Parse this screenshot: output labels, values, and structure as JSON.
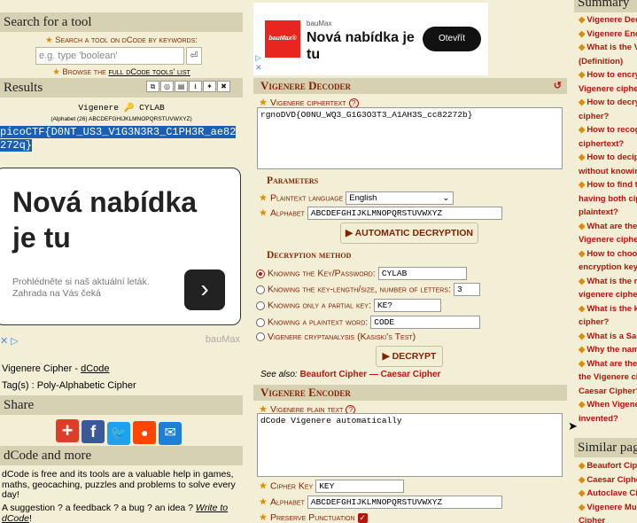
{
  "left": {
    "search_title": "Search for a tool",
    "search_hint": "Search a tool on dCode by keywords:",
    "search_placeholder": "e.g. type 'boolean'",
    "browse_prefix": "Browse the ",
    "browse_link": "full dCode tools' list",
    "results_title": "Results",
    "result_tool": "Vigenere",
    "result_key": "CYLAB",
    "result_alphabet": "(Alphabet (26) ABCDEFGHIJKLMNOPQRSTUVWXYZ)",
    "result_text_line1": "picoCTF{D0NT_US3_V1G3N3R3_C1PH3R_ae82",
    "result_text_line2": "272q}",
    "ad_title": "Nová nabídka je tu",
    "ad_text": "Prohlédněte si naš aktuální leták. Zahrada na Vás čeká",
    "ad_brand": "bauMax",
    "tool_name_prefix": "Vigenere Cipher - ",
    "tool_name_link": "dCode",
    "tags": "Tag(s) : Poly-Alphabetic Cipher",
    "share_title": "Share",
    "more_title": "dCode and more",
    "more_text_1": "dCode is free and its tools are a valuable help in games, maths, geocaching, puzzles and problems to solve every day!",
    "more_text_2a": "A suggestion ? a feedback ? a bug ? an idea ? ",
    "more_text_2b": "Write to dCode",
    "more_text_2c": "!",
    "toolbar_icons": [
      "copy-icon",
      "screenshot-icon",
      "print-icon",
      "download-icon",
      "pin-icon",
      "close-icon"
    ]
  },
  "top_ad": {
    "brand": "bauMax",
    "logo_text": "bauMax®",
    "title": "Nová nabídka je tu",
    "button": "Otevřít"
  },
  "decoder": {
    "title": "Vigenere Decoder",
    "cipher_label": "Vigenere ciphertext",
    "cipher_value": "rgnoDVD{O0NU_WQ3_G1G3O3T3_A1AH3S_cc82272b}",
    "params_title": "Parameters",
    "lang_label": "Plaintext language",
    "lang_value": "English",
    "alphabet_label": "Alphabet",
    "alphabet_value": "ABCDEFGHIJKLMNOPQRSTUVWXYZ",
    "auto_button": "▶ AUTOMATIC DECRYPTION",
    "method_title": "Decryption method",
    "opt1_label": "Knowing the Key/Password:",
    "opt1_value": "CYLAB",
    "opt2_label": "Knowing the key-length/size, number of letters:",
    "opt2_value": "3",
    "opt3_label": "Knowing only a partial key:",
    "opt3_value": "KE?",
    "opt4_label": "Knowing a plaintext word:",
    "opt4_value": "CODE",
    "opt5_label": "Vigenere cryptanalysis (Kasiski's Test)",
    "decrypt_button": "▶ DECRYPT",
    "see_also": "See also:",
    "see_link1": "Beaufort Cipher",
    "see_dash": " — ",
    "see_link2": "Caesar Cipher"
  },
  "encoder": {
    "title": "Vigenere Encoder",
    "plain_label": "Vigenere plain text",
    "plain_value": "dCode Vigenere automatically",
    "key_label": "Cipher Key",
    "key_value": "KEY",
    "alphabet_label": "Alphabet",
    "alphabet_value": "ABCDEFGHIJKLMNOPQRSTUVWXYZ",
    "punct_label": "Preserve Punctuation"
  },
  "summary": {
    "title": "Summary",
    "items": [
      "Vigenere Dec",
      "Vigenere Enc",
      "What is the V",
      "(Definition)",
      "How to encry",
      "Vigenere ciphe",
      "How to decry",
      "cipher?",
      "How to recog",
      "ciphertext?",
      "How to decip",
      "without knowin",
      "How to find t",
      "having both cip",
      "plaintext?",
      "What are the",
      "Vigenere ciphe",
      "How to choo",
      "encryption key",
      "What is the r",
      "vigenere ciphe",
      "What is the k",
      "cipher?",
      "What is a Sa",
      "Why the nam",
      "What are the",
      "the Vigenere ci",
      "Caesar Cipher?",
      "When Vigene",
      "invented?"
    ],
    "bullets": [
      true,
      true,
      true,
      false,
      true,
      false,
      true,
      false,
      true,
      false,
      true,
      false,
      true,
      false,
      false,
      true,
      false,
      true,
      false,
      true,
      false,
      true,
      false,
      true,
      true,
      true,
      false,
      false,
      true,
      false
    ],
    "similar_title": "Similar pag",
    "similar_items": [
      "Beaufort Cip",
      "Caesar Ciphe",
      "Autoclave Ci",
      "Vigenere Mu",
      "Cipher"
    ],
    "similar_bullets": [
      true,
      true,
      true,
      true,
      false
    ]
  },
  "colors": {
    "accent": "#822300",
    "link_red": "#b8140e",
    "panel": "#f3efd6",
    "header": "#d6d1b3",
    "selection": "#1a5fb4"
  }
}
